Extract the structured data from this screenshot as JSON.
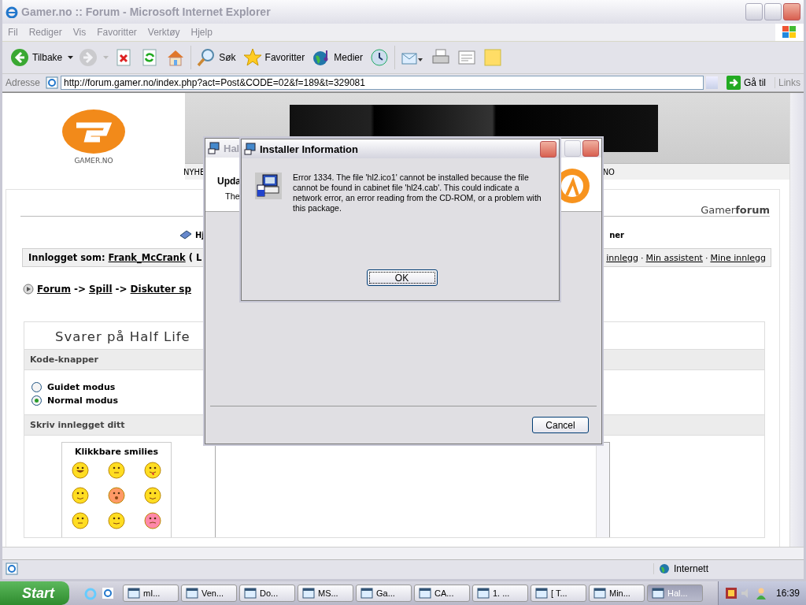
{
  "window": {
    "title": "Gamer.no :: Forum - Microsoft Internet Explorer",
    "active": false
  },
  "menu": [
    "Fil",
    "Rediger",
    "Vis",
    "Favoritter",
    "Verktøy",
    "Hjelp"
  ],
  "toolbar": [
    {
      "kind": "back",
      "label": "Tilbake",
      "disabled": false
    },
    {
      "kind": "forward",
      "disabled": true
    },
    {
      "kind": "stop",
      "disabled": false
    },
    {
      "kind": "refresh",
      "disabled": false
    },
    {
      "kind": "home",
      "disabled": false
    },
    {
      "kind": "search",
      "label": "Søk",
      "disabled": false
    },
    {
      "kind": "favorites",
      "label": "Favoritter",
      "disabled": false
    },
    {
      "kind": "media",
      "label": "Medier",
      "disabled": false
    },
    {
      "kind": "history",
      "disabled": false
    },
    {
      "kind": "mail",
      "disabled": false
    },
    {
      "kind": "print",
      "disabled": false
    },
    {
      "kind": "edit",
      "disabled": false
    },
    {
      "kind": "note",
      "disabled": false
    }
  ],
  "address": {
    "label": "Adresse",
    "url": "http://forum.gamer.no/index.php?act=Post&CODE=02&f=189&t=329081",
    "go": "Gå til",
    "links": "Links"
  },
  "page": {
    "logo_text": "GAMER.NO",
    "nav": [
      "NYHE",
      "NO"
    ],
    "forum_title": "Gamer**forum**",
    "help": [
      "Hj",
      "ner"
    ],
    "login": {
      "label": "Innlogget som:",
      "user": "Frank_McCrank",
      "after": "( L",
      "links": [
        {
          "kind": "link",
          "text": "innlegg"
        },
        {
          "kind": "separator",
          "text": "·"
        },
        {
          "kind": "link",
          "text": "Min assistent"
        },
        {
          "kind": "separator",
          "text": "·"
        },
        {
          "kind": "link",
          "text": "Mine innlegg"
        }
      ]
    },
    "breadcrumb": [
      {
        "kind": "link",
        "text": "Forum"
      },
      {
        "kind": "separator",
        "text": "->"
      },
      {
        "kind": "link",
        "text": "Spill"
      },
      {
        "kind": "separator",
        "text": "->"
      },
      {
        "kind": "link",
        "text": "Diskuter sp"
      }
    ],
    "reply_title": "Svarer på Half Life",
    "code_section": "Kode-knapper",
    "modes": [
      {
        "label": "Guidet modus",
        "selected": false
      },
      {
        "label": "Normal modus",
        "selected": true
      }
    ],
    "write_section": "Skriv innlegget ditt",
    "smilies_title": "Klikkbare smilies"
  },
  "installer_window": {
    "title": "Hal",
    "active": false,
    "heading": "Upda",
    "text": "The",
    "button": "Cancel"
  },
  "error_dialog": {
    "title": "Installer Information",
    "active": true,
    "message": "Error 1334. The file 'hl2.ico1' cannot be installed because the file cannot be found in cabinet file 'hl24.cab'. This could indicate a network error, an error reading from the CD-ROM, or a problem with this package.",
    "button": "OK"
  },
  "status_bar": {
    "zone": "Internett"
  },
  "taskbar": {
    "start": "Start",
    "tasks": [
      {
        "label": "mI...",
        "selected": false
      },
      {
        "label": "Ven...",
        "selected": false
      },
      {
        "label": "Do...",
        "selected": false
      },
      {
        "label": "MS...",
        "selected": false
      },
      {
        "label": "Ga...",
        "selected": false
      },
      {
        "label": "CA...",
        "selected": false
      },
      {
        "label": "1. ...",
        "selected": false
      },
      {
        "label": "[ T...",
        "selected": false
      },
      {
        "label": "Min...",
        "selected": false
      },
      {
        "label": "Hal...",
        "selected": true
      }
    ],
    "clock": "16:39"
  }
}
